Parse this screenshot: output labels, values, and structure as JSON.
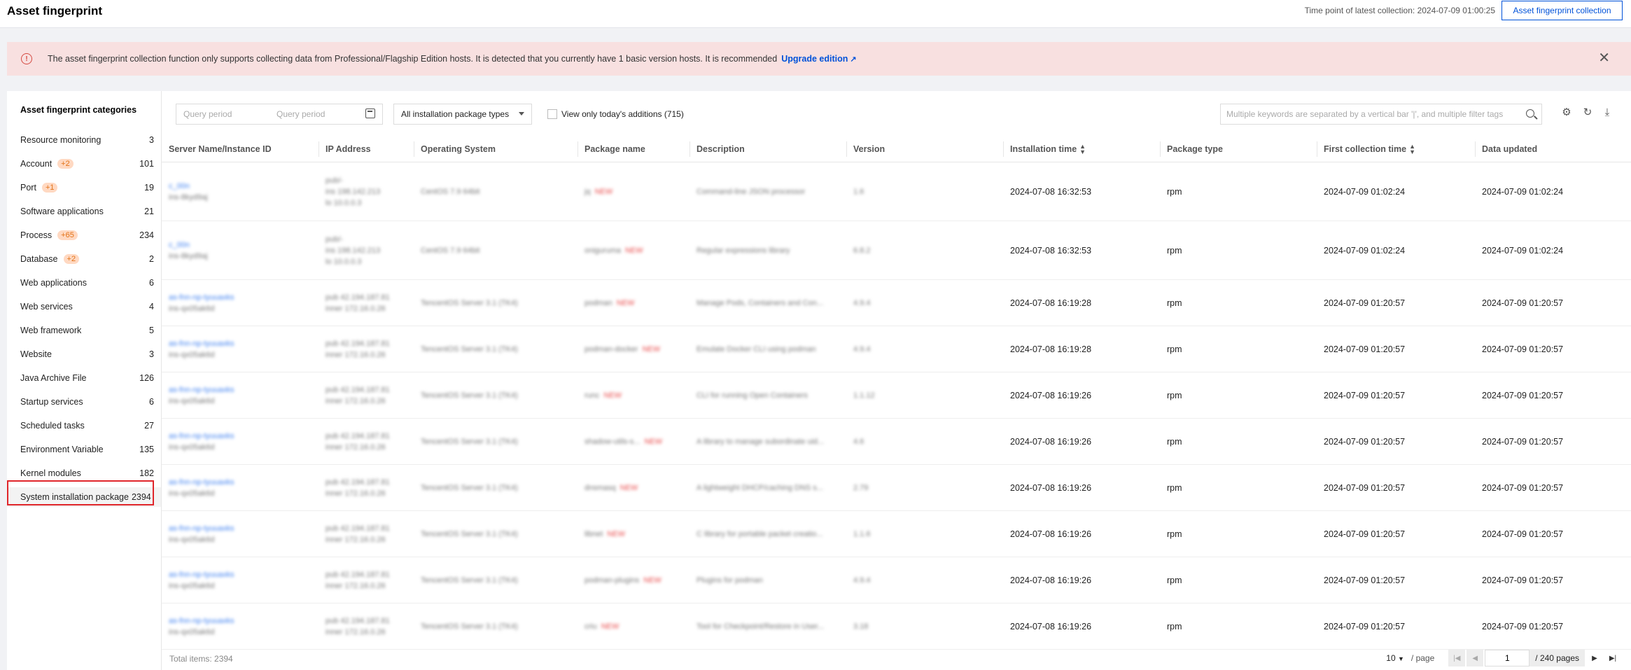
{
  "header": {
    "title": "Asset fingerprint",
    "collection_time": "Time point of latest collection: 2024-07-09 01:00:25",
    "collect_button": "Asset fingerprint collection"
  },
  "alert": {
    "icon": "exclamation-circle-icon",
    "text": "The asset fingerprint collection function only supports collecting data from Professional/Flagship Edition hosts. It is detected that you currently have 1 basic version hosts. It is recommended",
    "link": "Upgrade edition",
    "link_icon": "↗",
    "close": "✕"
  },
  "sidebar": {
    "title": "Asset fingerprint categories",
    "items": [
      {
        "label": "Resource monitoring",
        "badge": "",
        "count": "3"
      },
      {
        "label": "Account",
        "badge": "+2",
        "count": "101"
      },
      {
        "label": "Port",
        "badge": "+1",
        "count": "19"
      },
      {
        "label": "Software applications",
        "badge": "",
        "count": "21"
      },
      {
        "label": "Process",
        "badge": "+65",
        "count": "234"
      },
      {
        "label": "Database",
        "badge": "+2",
        "count": "2"
      },
      {
        "label": "Web applications",
        "badge": "",
        "count": "6"
      },
      {
        "label": "Web services",
        "badge": "",
        "count": "4"
      },
      {
        "label": "Web framework",
        "badge": "",
        "count": "5"
      },
      {
        "label": "Website",
        "badge": "",
        "count": "3"
      },
      {
        "label": "Java Archive File",
        "badge": "",
        "count": "126"
      },
      {
        "label": "Startup services",
        "badge": "",
        "count": "6"
      },
      {
        "label": "Scheduled tasks",
        "badge": "",
        "count": "27"
      },
      {
        "label": "Environment Variable",
        "badge": "",
        "count": "135"
      },
      {
        "label": "Kernel modules",
        "badge": "",
        "count": "182"
      },
      {
        "label": "System installation package",
        "badge": "",
        "count": "2394"
      }
    ]
  },
  "filters": {
    "date_start_placeholder": "Query period",
    "date_end_placeholder": "Query period",
    "package_type": "All installation package types",
    "today_label": "View only today's additions (715)",
    "search_placeholder": "Multiple keywords are separated by a vertical bar '|', and multiple filter tags"
  },
  "table": {
    "columns": [
      "Server Name/Instance ID",
      "IP Address",
      "Operating System",
      "Package name",
      "Description",
      "Version",
      "Installation time",
      "Package type",
      "First collection time",
      "Data updated"
    ],
    "new_tag": "NEW",
    "rows": [
      {
        "server": "c_00n",
        "instance": "ins-8kyd9aj",
        "ip": [
          "pub/-",
          "ins 198.142.213",
          "lo 10.0.0.3"
        ],
        "os": "CentOS 7.9 64bit",
        "pkg": "jq",
        "desc": "Command-line JSON processor",
        "ver": "1.6",
        "install": "2024-07-08 16:32:53",
        "type": "rpm",
        "first": "2024-07-09 01:02:24",
        "updated": "2024-07-09 01:02:24"
      },
      {
        "server": "c_00n",
        "instance": "ins-8kyd9aj",
        "ip": [
          "pub/-",
          "ins 198.142.213",
          "lo 10.0.0.3"
        ],
        "os": "CentOS 7.9 64bit",
        "pkg": "oniguruma",
        "desc": "Regular expressions library",
        "ver": "6.8.2",
        "install": "2024-07-08 16:32:53",
        "type": "rpm",
        "first": "2024-07-09 01:02:24",
        "updated": "2024-07-09 01:02:24"
      },
      {
        "server": "as-fnn-np-tyuuaxks",
        "instance": "ins-qx05ak6d",
        "ip": [
          "pub 42.194.187.81",
          "inner 172.16.0.26"
        ],
        "os": "TencentOS Server 3.1 (TK4)",
        "pkg": "podman",
        "desc": "Manage Pods, Containers and Con...",
        "ver": "4.9.4",
        "install": "2024-07-08 16:19:28",
        "type": "rpm",
        "first": "2024-07-09 01:20:57",
        "updated": "2024-07-09 01:20:57"
      },
      {
        "server": "as-fnn-np-tyuuaxks",
        "instance": "ins-qx05ak6d",
        "ip": [
          "pub 42.194.187.81",
          "inner 172.16.0.26"
        ],
        "os": "TencentOS Server 3.1 (TK4)",
        "pkg": "podman-docker",
        "desc": "Emulate Docker CLI using podman",
        "ver": "4.9.4",
        "install": "2024-07-08 16:19:28",
        "type": "rpm",
        "first": "2024-07-09 01:20:57",
        "updated": "2024-07-09 01:20:57"
      },
      {
        "server": "as-fnn-np-tyuuaxks",
        "instance": "ins-qx05ak6d",
        "ip": [
          "pub 42.194.187.81",
          "inner 172.16.0.26"
        ],
        "os": "TencentOS Server 3.1 (TK4)",
        "pkg": "runc",
        "desc": "CLI for running Open Containers",
        "ver": "1.1.12",
        "install": "2024-07-08 16:19:26",
        "type": "rpm",
        "first": "2024-07-09 01:20:57",
        "updated": "2024-07-09 01:20:57"
      },
      {
        "server": "as-fnn-np-tyuuaxks",
        "instance": "ins-qx05ak6d",
        "ip": [
          "pub 42.194.187.81",
          "inner 172.16.0.26"
        ],
        "os": "TencentOS Server 3.1 (TK4)",
        "pkg": "shadow-utils-s...",
        "desc": "A library to manage subordinate uid...",
        "ver": "4.6",
        "install": "2024-07-08 16:19:26",
        "type": "rpm",
        "first": "2024-07-09 01:20:57",
        "updated": "2024-07-09 01:20:57"
      },
      {
        "server": "as-fnn-np-tyuuaxks",
        "instance": "ins-qx05ak6d",
        "ip": [
          "pub 42.194.187.81",
          "inner 172.16.0.26"
        ],
        "os": "TencentOS Server 3.1 (TK4)",
        "pkg": "dnsmasq",
        "desc": "A lightweight DHCP/caching DNS s...",
        "ver": "2.79",
        "install": "2024-07-08 16:19:26",
        "type": "rpm",
        "first": "2024-07-09 01:20:57",
        "updated": "2024-07-09 01:20:57"
      },
      {
        "server": "as-fnn-np-tyuuaxks",
        "instance": "ins-qx05ak6d",
        "ip": [
          "pub 42.194.187.81",
          "inner 172.16.0.26"
        ],
        "os": "TencentOS Server 3.1 (TK4)",
        "pkg": "libnet",
        "desc": "C library for portable packet creatio...",
        "ver": "1.1.6",
        "install": "2024-07-08 16:19:26",
        "type": "rpm",
        "first": "2024-07-09 01:20:57",
        "updated": "2024-07-09 01:20:57"
      },
      {
        "server": "as-fnn-np-tyuuaxks",
        "instance": "ins-qx05ak6d",
        "ip": [
          "pub 42.194.187.81",
          "inner 172.16.0.26"
        ],
        "os": "TencentOS Server 3.1 (TK4)",
        "pkg": "podman-plugins",
        "desc": "Plugins for podman",
        "ver": "4.9.4",
        "install": "2024-07-08 16:19:26",
        "type": "rpm",
        "first": "2024-07-09 01:20:57",
        "updated": "2024-07-09 01:20:57"
      },
      {
        "server": "as-fnn-np-tyuuaxks",
        "instance": "ins-qx05ak6d",
        "ip": [
          "pub 42.194.187.81",
          "inner 172.16.0.26"
        ],
        "os": "TencentOS Server 3.1 (TK4)",
        "pkg": "criu",
        "desc": "Tool for Checkpoint/Restore in User...",
        "ver": "3.18",
        "install": "2024-07-08 16:19:26",
        "type": "rpm",
        "first": "2024-07-09 01:20:57",
        "updated": "2024-07-09 01:20:57"
      }
    ]
  },
  "footer": {
    "total": "Total items: 2394",
    "page_size": "10",
    "per_page": "/ page",
    "current_page": "1",
    "pages": "/ 240 pages"
  },
  "colors": {
    "accent": "#0052d9",
    "alert_bg": "#f8e0e0",
    "badge_bg": "#ffd9c2",
    "badge_text": "#e37318",
    "highlight": "#e0262b"
  }
}
